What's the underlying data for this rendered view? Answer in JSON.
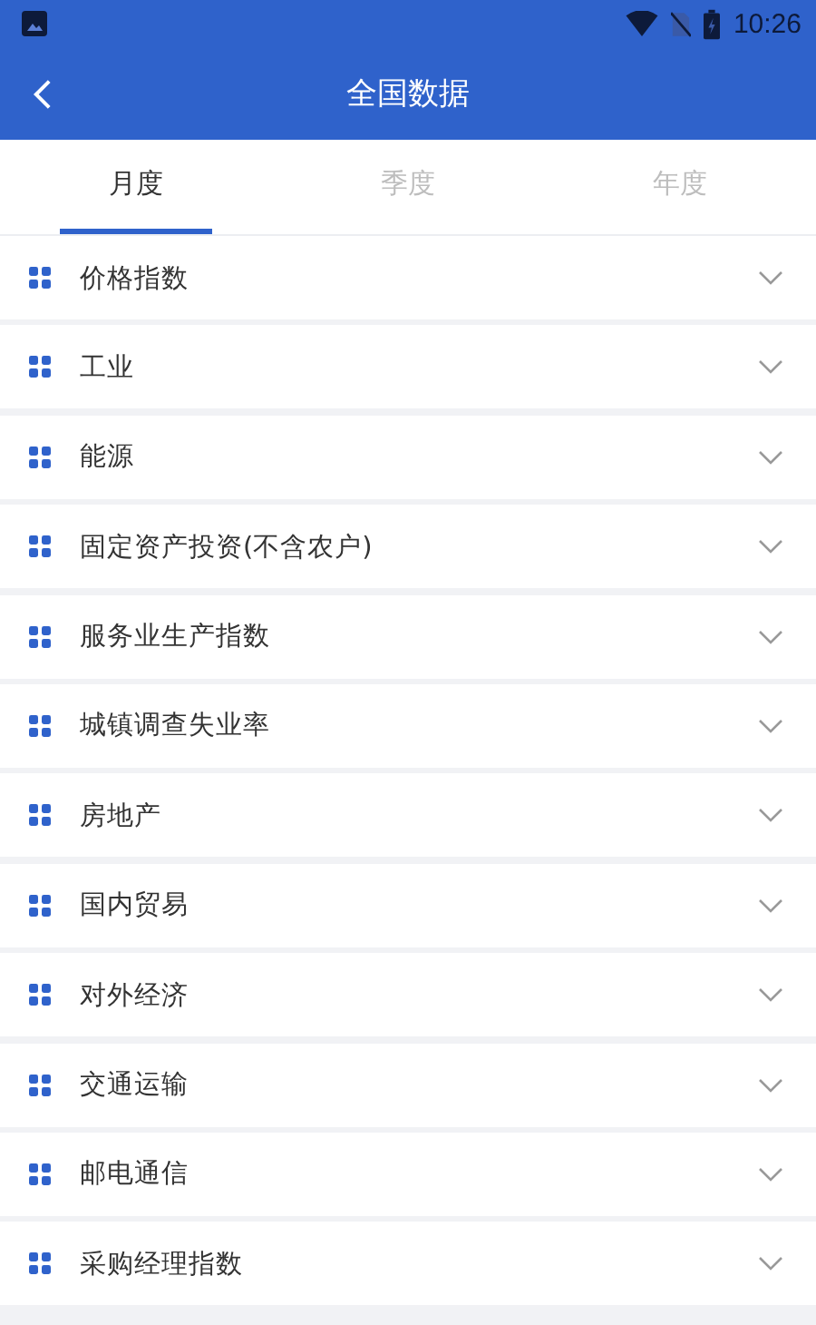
{
  "status_bar": {
    "time": "10:26"
  },
  "app_bar": {
    "title": "全国数据"
  },
  "tabs": [
    {
      "label": "月度",
      "selected": true
    },
    {
      "label": "季度",
      "selected": false
    },
    {
      "label": "年度",
      "selected": false
    }
  ],
  "categories": [
    {
      "label": "价格指数",
      "expanded": false
    },
    {
      "label": "工业",
      "expanded": false
    },
    {
      "label": "能源",
      "expanded": false
    },
    {
      "label": "固定资产投资(不含农户)",
      "expanded": false
    },
    {
      "label": "服务业生产指数",
      "expanded": false
    },
    {
      "label": "城镇调查失业率",
      "expanded": false
    },
    {
      "label": "房地产",
      "expanded": false
    },
    {
      "label": "国内贸易",
      "expanded": false
    },
    {
      "label": "对外经济",
      "expanded": false
    },
    {
      "label": "交通运输",
      "expanded": false
    },
    {
      "label": "邮电通信",
      "expanded": false
    },
    {
      "label": "采购经理指数",
      "expanded": false
    }
  ]
}
